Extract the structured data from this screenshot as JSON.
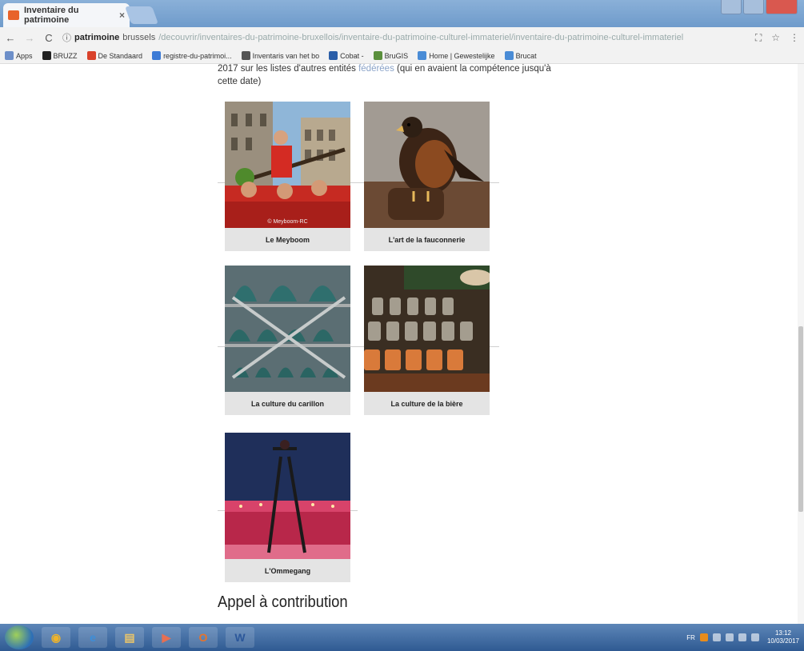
{
  "browser": {
    "tab_title": "Inventaire du patrimoine",
    "tab_close": "×",
    "url_domain": "patrimoine",
    "url_domain2": "brussels",
    "url_path": "/decouvrir/inventaires-du-patrimoine-bruxellois/inventaire-du-patrimoine-culturel-immateriel/inventaire-du-patrimoine-culturel-immateriel",
    "bookmarks": [
      {
        "label": "Apps",
        "icon": "apps-grid-icon",
        "color": "#6d8fc9"
      },
      {
        "label": "BRUZZ",
        "icon": "bruzz-icon",
        "color": "#222222"
      },
      {
        "label": "De Standaard",
        "icon": "destandaard-icon",
        "color": "#d9422b"
      },
      {
        "label": "registre-du-patrimoi...",
        "icon": "globe-icon",
        "color": "#3d7bd6"
      },
      {
        "label": "Inventaris van het bo",
        "icon": "building-icon",
        "color": "#555555"
      },
      {
        "label": "Cobat -",
        "icon": "cobat-icon",
        "color": "#2b5ea8"
      },
      {
        "label": "BruGIS",
        "icon": "map-icon",
        "color": "#5a8f3c"
      },
      {
        "label": "Home | Gewestelijke",
        "icon": "cloud-icon",
        "color": "#4a8cd6"
      },
      {
        "label": "Brucat",
        "icon": "cloud-icon",
        "color": "#4a8cd6"
      }
    ]
  },
  "page": {
    "intro_text": "2017 sur les listes d'autres entités",
    "intro_link": "fédérées",
    "intro_rest": "(qui en avaient la compétence jusqu'à",
    "intro_line2": "cette date)",
    "cards": [
      {
        "caption": "Le Meyboom",
        "credit": "© Meyboom-RC"
      },
      {
        "caption": "L'art de la fauconnerie",
        "credit": ""
      },
      {
        "caption": "La culture du carillon",
        "credit": ""
      },
      {
        "caption": "La culture de la bière",
        "credit": ""
      },
      {
        "caption": "L'Ommegang",
        "credit": ""
      }
    ],
    "section_title": "Appel à contribution"
  },
  "taskbar": {
    "apps": [
      {
        "name": "chrome",
        "glyph": "◉"
      },
      {
        "name": "internet-explorer",
        "glyph": "e"
      },
      {
        "name": "file-explorer",
        "glyph": "▤"
      },
      {
        "name": "media-player",
        "glyph": "▶"
      },
      {
        "name": "outlook",
        "glyph": "O"
      },
      {
        "name": "word",
        "glyph": "W"
      }
    ],
    "lang": "FR",
    "time": "13:12",
    "date": "10/03/2017"
  }
}
